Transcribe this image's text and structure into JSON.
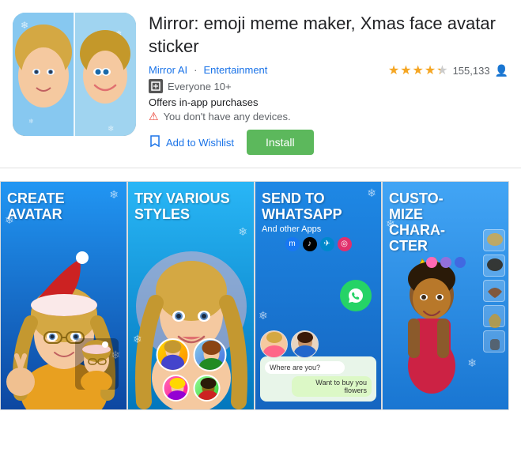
{
  "app": {
    "title": "Mirror: emoji meme maker, Xmas face avatar sticker",
    "publisher": "Mirror AI",
    "category": "Entertainment",
    "rating_value": "4.3",
    "rating_count": "155,133",
    "age_rating": "E10+",
    "age_label": "Everyone 10+",
    "iap_label": "Offers in-app purchases",
    "warning_text": "You don't have any devices.",
    "wishlist_label": "Add to Wishlist",
    "install_label": "Install"
  },
  "screenshots": [
    {
      "title": "CREATE AVATAR",
      "subtitle": "",
      "index": 0
    },
    {
      "title": "TRY VARIOUS STYLES",
      "subtitle": "",
      "index": 1
    },
    {
      "title": "SEND TO WHATSAPP",
      "subtitle": "And other Apps",
      "index": 2
    },
    {
      "title": "CUSTO CHARA",
      "subtitle": "",
      "index": 3
    }
  ],
  "chat": {
    "msg1": "Where are you?",
    "msg2": "Want to buy you flowers"
  },
  "icons": {
    "star_filled": "★",
    "star_empty": "★",
    "warning": "⚠",
    "bookmark": "🔖",
    "shield": "🛡"
  }
}
